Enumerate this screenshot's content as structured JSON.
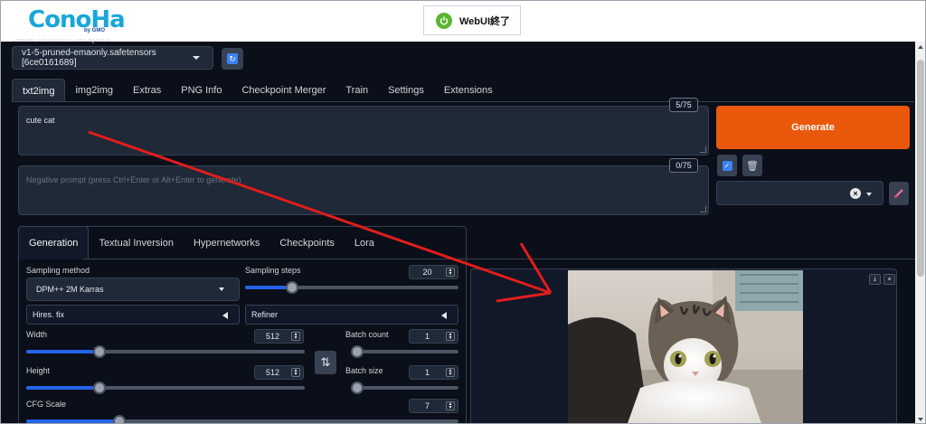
{
  "header": {
    "logo_text": "ConoHa",
    "logo_sub": "by GMO",
    "quit_label": "WebUI終了"
  },
  "checkpoint": {
    "label": "Stable Diffusion checkpoint",
    "value": "v1-5-pruned-emaonly.safetensors [6ce0161689]"
  },
  "tabs": [
    "txt2img",
    "img2img",
    "Extras",
    "PNG Info",
    "Checkpoint Merger",
    "Train",
    "Settings",
    "Extensions"
  ],
  "prompt": {
    "value": "cute cat",
    "token_count": "5/75"
  },
  "negative_prompt": {
    "placeholder": "Negative prompt (press Ctrl+Enter or Alt+Enter to generate)",
    "token_count": "0/75"
  },
  "generate_label": "Generate",
  "subtabs": [
    "Generation",
    "Textual Inversion",
    "Hypernetworks",
    "Checkpoints",
    "Lora"
  ],
  "settings": {
    "sampling_method_label": "Sampling method",
    "sampling_method_value": "DPM++ 2M Karras",
    "sampling_steps_label": "Sampling steps",
    "sampling_steps_value": "20",
    "sampling_steps_fraction": 0.19,
    "hires_label": "Hires. fix",
    "refiner_label": "Refiner",
    "width_label": "Width",
    "width_value": "512",
    "width_fraction": 0.24,
    "height_label": "Height",
    "height_value": "512",
    "height_fraction": 0.24,
    "batch_count_label": "Batch count",
    "batch_count_value": "1",
    "batch_count_fraction": 0.0,
    "batch_size_label": "Batch size",
    "batch_size_value": "1",
    "batch_size_fraction": 0.0,
    "cfg_label": "CFG Scale",
    "cfg_value": "7",
    "cfg_fraction": 0.2
  },
  "output": {
    "image_subject": "kitten"
  },
  "colors": {
    "accent": "#ea580c",
    "slider": "#2563eb",
    "annotation_arrow": "#e11d1d",
    "logo": "#19a6d8"
  }
}
